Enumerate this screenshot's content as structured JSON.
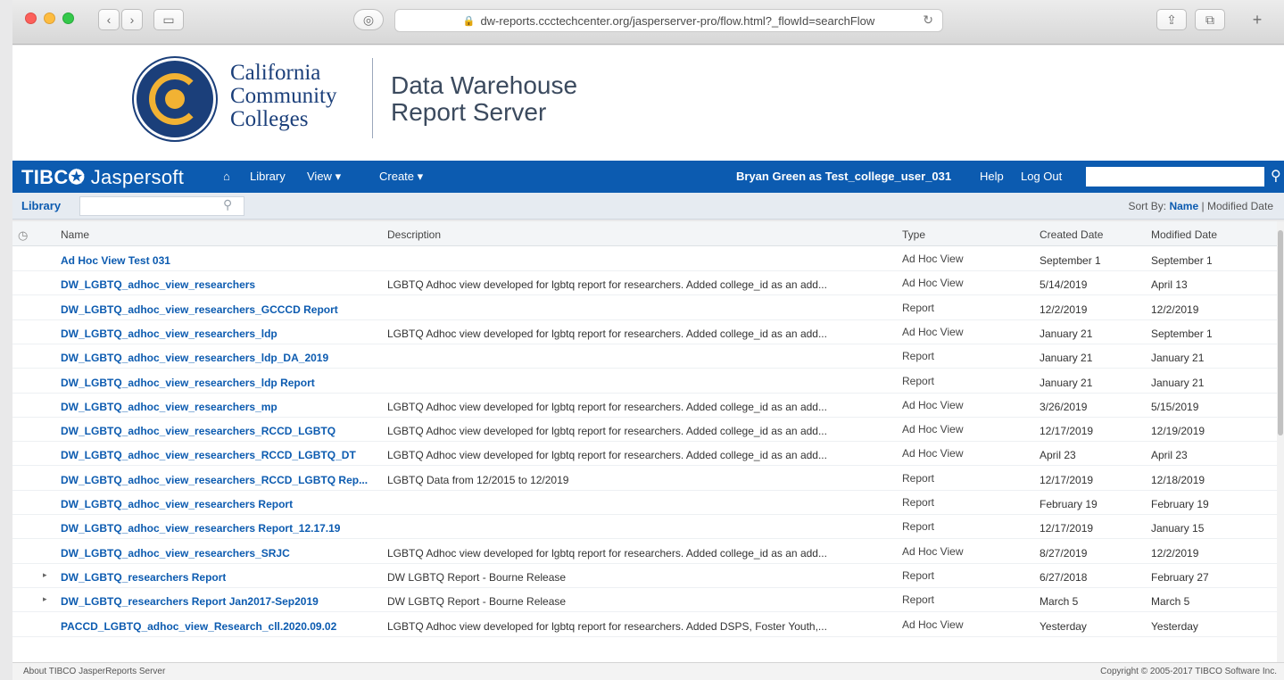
{
  "browser": {
    "url": "dw-reports.ccctechcenter.org/jasperserver-pro/flow.html?_flowId=searchFlow"
  },
  "brand": {
    "college_line1": "California",
    "college_line2": "Community",
    "college_line3": "Colleges",
    "title_line1": "Data Warehouse",
    "title_line2": "Report Server"
  },
  "nav": {
    "logo_a": "TIBC",
    "logo_b": "Jaspersoft",
    "library": "Library",
    "view": "View",
    "create": "Create",
    "user": "Bryan Green as Test_college_user_031",
    "help": "Help",
    "logout": "Log Out"
  },
  "library": {
    "label": "Library",
    "sort_by": "Sort By:",
    "sort_name": "Name",
    "sort_modified": "Modified Date"
  },
  "columns": {
    "name": "Name",
    "description": "Description",
    "type": "Type",
    "created": "Created Date",
    "modified": "Modified Date"
  },
  "rows": [
    {
      "name": "Ad Hoc View Test 031",
      "description": "",
      "type": "Ad Hoc View",
      "created": "September 1",
      "modified": "September 1",
      "expand": ""
    },
    {
      "name": "DW_LGBTQ_adhoc_view_researchers",
      "description": "LGBTQ Adhoc view developed for lgbtq report for researchers. Added college_id as an add...",
      "type": "Ad Hoc View",
      "created": "5/14/2019",
      "modified": "April 13",
      "expand": ""
    },
    {
      "name": "DW_LGBTQ_adhoc_view_researchers_GCCCD Report",
      "description": "",
      "type": "Report",
      "created": "12/2/2019",
      "modified": "12/2/2019",
      "expand": ""
    },
    {
      "name": "DW_LGBTQ_adhoc_view_researchers_ldp",
      "description": "LGBTQ Adhoc view developed for lgbtq report for researchers. Added college_id as an add...",
      "type": "Ad Hoc View",
      "created": "January 21",
      "modified": "September 1",
      "expand": ""
    },
    {
      "name": "DW_LGBTQ_adhoc_view_researchers_ldp_DA_2019",
      "description": "",
      "type": "Report",
      "created": "January 21",
      "modified": "January 21",
      "expand": ""
    },
    {
      "name": "DW_LGBTQ_adhoc_view_researchers_ldp Report",
      "description": "",
      "type": "Report",
      "created": "January 21",
      "modified": "January 21",
      "expand": ""
    },
    {
      "name": "DW_LGBTQ_adhoc_view_researchers_mp",
      "description": "LGBTQ Adhoc view developed for lgbtq report for researchers. Added college_id as an add...",
      "type": "Ad Hoc View",
      "created": "3/26/2019",
      "modified": "5/15/2019",
      "expand": ""
    },
    {
      "name": "DW_LGBTQ_adhoc_view_researchers_RCCD_LGBTQ",
      "description": "LGBTQ Adhoc view developed for lgbtq report for researchers. Added college_id as an add...",
      "type": "Ad Hoc View",
      "created": "12/17/2019",
      "modified": "12/19/2019",
      "expand": ""
    },
    {
      "name": "DW_LGBTQ_adhoc_view_researchers_RCCD_LGBTQ_DT",
      "description": "LGBTQ Adhoc view developed for lgbtq report for researchers. Added college_id as an add...",
      "type": "Ad Hoc View",
      "created": "April 23",
      "modified": "April 23",
      "expand": ""
    },
    {
      "name": "DW_LGBTQ_adhoc_view_researchers_RCCD_LGBTQ Rep...",
      "description": "LGBTQ Data from 12/2015 to 12/2019",
      "type": "Report",
      "created": "12/17/2019",
      "modified": "12/18/2019",
      "expand": ""
    },
    {
      "name": "DW_LGBTQ_adhoc_view_researchers Report",
      "description": "",
      "type": "Report",
      "created": "February 19",
      "modified": "February 19",
      "expand": ""
    },
    {
      "name": "DW_LGBTQ_adhoc_view_researchers Report_12.17.19",
      "description": "",
      "type": "Report",
      "created": "12/17/2019",
      "modified": "January 15",
      "expand": ""
    },
    {
      "name": "DW_LGBTQ_adhoc_view_researchers_SRJC",
      "description": "LGBTQ Adhoc view developed for lgbtq report for researchers. Added college_id as an add...",
      "type": "Ad Hoc View",
      "created": "8/27/2019",
      "modified": "12/2/2019",
      "expand": ""
    },
    {
      "name": "DW_LGBTQ_researchers Report",
      "description": "DW LGBTQ Report - Bourne Release",
      "type": "Report",
      "created": "6/27/2018",
      "modified": "February 27",
      "expand": "▸"
    },
    {
      "name": "DW_LGBTQ_researchers Report Jan2017-Sep2019",
      "description": "DW LGBTQ Report - Bourne Release",
      "type": "Report",
      "created": "March 5",
      "modified": "March 5",
      "expand": "▸"
    },
    {
      "name": "PACCD_LGBTQ_adhoc_view_Research_cll.2020.09.02",
      "description": "LGBTQ Adhoc view developed for lgbtq report for researchers. Added DSPS, Foster Youth,...",
      "type": "Ad Hoc View",
      "created": "Yesterday",
      "modified": "Yesterday",
      "expand": ""
    }
  ],
  "footer": {
    "about": "About TIBCO JasperReports Server",
    "copyright": "Copyright © 2005-2017 TIBCO Software Inc."
  }
}
